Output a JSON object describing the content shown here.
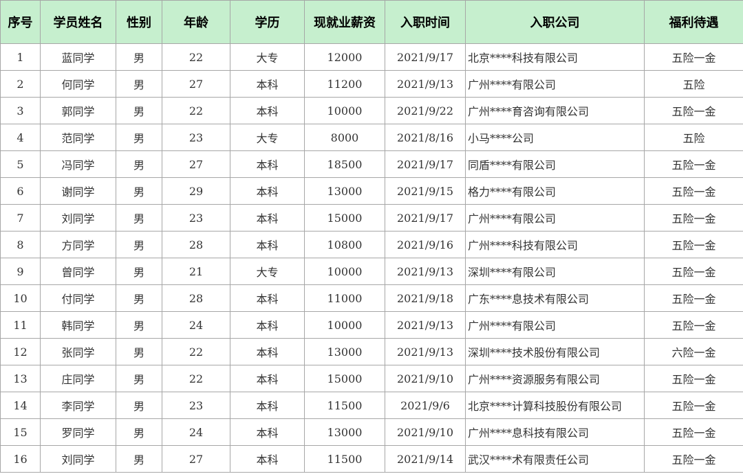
{
  "columns": [
    "序号",
    "学员姓名",
    "性别",
    "年龄",
    "学历",
    "现就业薪资",
    "入职时间",
    "入职公司",
    "福利待遇"
  ],
  "rows": [
    [
      "1",
      "蓝同学",
      "男",
      "22",
      "大专",
      "12000",
      "2021/9/17",
      "北京****科技有限公司",
      "五险一金"
    ],
    [
      "2",
      "何同学",
      "男",
      "27",
      "本科",
      "11200",
      "2021/9/13",
      "广州****有限公司",
      "五险"
    ],
    [
      "3",
      "郭同学",
      "男",
      "22",
      "本科",
      "10000",
      "2021/9/22",
      "广州****育咨询有限公司",
      "五险一金"
    ],
    [
      "4",
      "范同学",
      "男",
      "23",
      "大专",
      "8000",
      "2021/8/16",
      "小马****公司",
      "五险"
    ],
    [
      "5",
      "冯同学",
      "男",
      "27",
      "本科",
      "18500",
      "2021/9/17",
      "同盾****有限公司",
      "五险一金"
    ],
    [
      "6",
      "谢同学",
      "男",
      "29",
      "本科",
      "13000",
      "2021/9/15",
      "格力****有限公司",
      "五险一金"
    ],
    [
      "7",
      "刘同学",
      "男",
      "23",
      "本科",
      "15000",
      "2021/9/17",
      "广州****有限公司",
      "五险一金"
    ],
    [
      "8",
      "方同学",
      "男",
      "28",
      "本科",
      "10800",
      "2021/9/16",
      "广州****科技有限公司",
      "五险一金"
    ],
    [
      "9",
      "曾同学",
      "男",
      "21",
      "大专",
      "10000",
      "2021/9/13",
      "深圳****有限公司",
      "五险一金"
    ],
    [
      "10",
      "付同学",
      "男",
      "28",
      "本科",
      "11000",
      "2021/9/18",
      "广东****息技术有限公司",
      "五险一金"
    ],
    [
      "11",
      "韩同学",
      "男",
      "24",
      "本科",
      "10000",
      "2021/9/13",
      "广州****有限公司",
      "五险一金"
    ],
    [
      "12",
      "张同学",
      "男",
      "22",
      "本科",
      "13000",
      "2021/9/13",
      "深圳****技术股份有限公司",
      "六险一金"
    ],
    [
      "13",
      "庄同学",
      "男",
      "22",
      "本科",
      "15000",
      "2021/9/10",
      "广州****资源服务有限公司",
      "五险一金"
    ],
    [
      "14",
      "李同学",
      "男",
      "23",
      "本科",
      "11500",
      "2021/9/6",
      "北京****计算科技股份有限公司",
      "五险一金"
    ],
    [
      "15",
      "罗同学",
      "男",
      "24",
      "本科",
      "13000",
      "2021/9/10",
      "广州****息科技有限公司",
      "五险一金"
    ],
    [
      "16",
      "刘同学",
      "男",
      "27",
      "本科",
      "11500",
      "2021/9/14",
      "武汉****术有限责任公司",
      "五险一金"
    ]
  ],
  "colors": {
    "header_bg": "#c6efce",
    "grid": "#a6a6a6",
    "text": "#333333"
  }
}
